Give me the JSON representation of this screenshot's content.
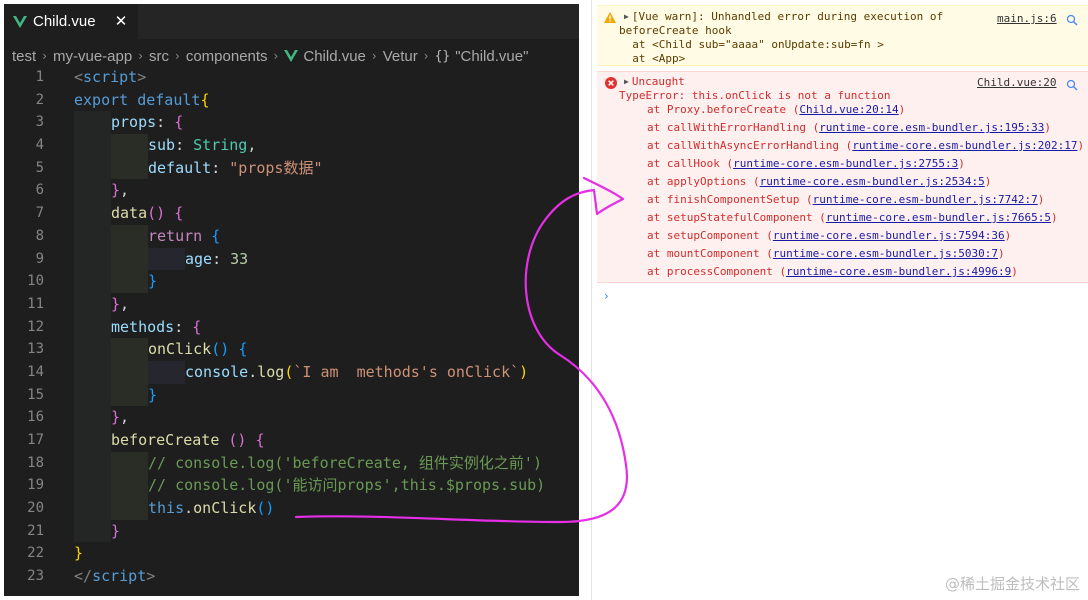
{
  "editor": {
    "tab": {
      "label": "Child.vue",
      "close_glyph": "✕"
    },
    "breadcrumb": [
      "test",
      "my-vue-app",
      "src",
      "components",
      "Child.vue",
      "Vetur",
      "\"Child.vue\""
    ],
    "braces_glyph": "{}",
    "lines": [
      {
        "n": "1",
        "indent": 0,
        "tokens": [
          [
            "t-punct-tag",
            "<"
          ],
          [
            "t-tag",
            "script"
          ],
          [
            "t-punct-tag",
            ">"
          ]
        ]
      },
      {
        "n": "2",
        "indent": 0,
        "tokens": [
          [
            "t-kw",
            "export"
          ],
          [
            "t-plain",
            " "
          ],
          [
            "t-kw",
            "default"
          ],
          [
            "t-brace1",
            "{"
          ]
        ]
      },
      {
        "n": "3",
        "indent": 1,
        "tokens": [
          [
            "t-prop",
            "props"
          ],
          [
            "t-plain",
            ": "
          ],
          [
            "t-brace2",
            "{"
          ]
        ]
      },
      {
        "n": "4",
        "indent": 2,
        "tokens": [
          [
            "t-prop",
            "sub"
          ],
          [
            "t-plain",
            ": "
          ],
          [
            "t-type",
            "String"
          ],
          [
            "t-plain",
            ","
          ]
        ]
      },
      {
        "n": "5",
        "indent": 2,
        "tokens": [
          [
            "t-prop",
            "default"
          ],
          [
            "t-plain",
            ": "
          ],
          [
            "t-str",
            "\"props数据\""
          ]
        ]
      },
      {
        "n": "6",
        "indent": 1,
        "tokens": [
          [
            "t-brace2",
            "}"
          ],
          [
            "t-plain",
            ","
          ]
        ]
      },
      {
        "n": "7",
        "indent": 1,
        "tokens": [
          [
            "t-fn",
            "data"
          ],
          [
            "t-brace2",
            "()"
          ],
          [
            "t-plain",
            " "
          ],
          [
            "t-brace2",
            "{"
          ]
        ]
      },
      {
        "n": "8",
        "indent": 2,
        "tokens": [
          [
            "t-ctrl",
            "return"
          ],
          [
            "t-plain",
            " "
          ],
          [
            "t-brace3",
            "{"
          ]
        ]
      },
      {
        "n": "9",
        "indent": 3,
        "tokens": [
          [
            "t-prop",
            "age"
          ],
          [
            "t-plain",
            ": "
          ],
          [
            "t-num",
            "33"
          ]
        ]
      },
      {
        "n": "10",
        "indent": 2,
        "tokens": [
          [
            "t-brace3",
            "}"
          ]
        ]
      },
      {
        "n": "11",
        "indent": 1,
        "tokens": [
          [
            "t-brace2",
            "}"
          ],
          [
            "t-plain",
            ","
          ]
        ]
      },
      {
        "n": "12",
        "indent": 1,
        "tokens": [
          [
            "t-prop",
            "methods"
          ],
          [
            "t-plain",
            ": "
          ],
          [
            "t-brace2",
            "{"
          ]
        ]
      },
      {
        "n": "13",
        "indent": 2,
        "tokens": [
          [
            "t-fn",
            "onClick"
          ],
          [
            "t-brace3",
            "()"
          ],
          [
            "t-plain",
            " "
          ],
          [
            "t-brace3",
            "{"
          ]
        ]
      },
      {
        "n": "14",
        "indent": 3,
        "tokens": [
          [
            "t-prop",
            "console"
          ],
          [
            "t-plain",
            "."
          ],
          [
            "t-fn",
            "log"
          ],
          [
            "t-brace1",
            "("
          ],
          [
            "t-str",
            "`I am  methods's onClick`"
          ],
          [
            "t-brace1",
            ")"
          ]
        ]
      },
      {
        "n": "15",
        "indent": 2,
        "tokens": [
          [
            "t-brace3",
            "}"
          ]
        ]
      },
      {
        "n": "16",
        "indent": 1,
        "tokens": [
          [
            "t-brace2",
            "}"
          ],
          [
            "t-plain",
            ","
          ]
        ]
      },
      {
        "n": "17",
        "indent": 1,
        "tokens": [
          [
            "t-fn",
            "beforeCreate"
          ],
          [
            "t-plain",
            " "
          ],
          [
            "t-brace2",
            "()"
          ],
          [
            "t-plain",
            " "
          ],
          [
            "t-brace2",
            "{"
          ]
        ]
      },
      {
        "n": "18",
        "indent": 2,
        "tokens": [
          [
            "t-cmt",
            "// console.log('beforeCreate, 组件实例化之前')"
          ]
        ]
      },
      {
        "n": "19",
        "indent": 2,
        "tokens": [
          [
            "t-cmt",
            "// console.log('能访问props',this.$props.sub)"
          ]
        ]
      },
      {
        "n": "20",
        "indent": 2,
        "tokens": [
          [
            "t-kw",
            "this"
          ],
          [
            "t-plain",
            "."
          ],
          [
            "t-fn",
            "onClick"
          ],
          [
            "t-brace3",
            "()"
          ]
        ]
      },
      {
        "n": "21",
        "indent": 1,
        "tokens": [
          [
            "t-brace2",
            "}"
          ]
        ]
      },
      {
        "n": "22",
        "indent": 0,
        "tokens": [
          [
            "t-brace1",
            "}"
          ]
        ]
      },
      {
        "n": "23",
        "indent": 0,
        "tokens": [
          [
            "t-punct-tag",
            "</"
          ],
          [
            "t-tag",
            "script"
          ],
          [
            "t-punct-tag",
            ">"
          ]
        ]
      }
    ]
  },
  "console": {
    "warning": {
      "lines": [
        "[Vue warn]: Unhandled error during execution of",
        "beforeCreate hook",
        "  at <Child sub=\"aaaa\" onUpdate:sub=fn >",
        "  at <App>"
      ],
      "source": "main.js:6"
    },
    "error": {
      "title": "Uncaught",
      "message": "TypeError: this.onClick is not a function",
      "source": "Child.vue:20",
      "stack": [
        {
          "fn": "at Proxy.beforeCreate (",
          "loc": "Child.vue:20:14",
          "end": ")"
        },
        {
          "fn": "at callWithErrorHandling (",
          "loc": "runtime-core.esm-bundler.js:195:33",
          "end": ")"
        },
        {
          "fn": "at callWithAsyncErrorHandling (",
          "loc": "runtime-core.esm-bundler.js:202:17",
          "end": ")"
        },
        {
          "fn": "at callHook (",
          "loc": "runtime-core.esm-bundler.js:2755:3",
          "end": ")"
        },
        {
          "fn": "at applyOptions (",
          "loc": "runtime-core.esm-bundler.js:2534:5",
          "end": ")"
        },
        {
          "fn": "at finishComponentSetup (",
          "loc": "runtime-core.esm-bundler.js:7742:7",
          "end": ")"
        },
        {
          "fn": "at setupStatefulComponent (",
          "loc": "runtime-core.esm-bundler.js:7665:5",
          "end": ")"
        },
        {
          "fn": "at setupComponent (",
          "loc": "runtime-core.esm-bundler.js:7594:36",
          "end": ")"
        },
        {
          "fn": "at mountComponent (",
          "loc": "runtime-core.esm-bundler.js:5030:7",
          "end": ")"
        },
        {
          "fn": "at processComponent (",
          "loc": "runtime-core.esm-bundler.js:4996:9",
          "end": ")"
        }
      ]
    },
    "prompt_glyph": "›"
  },
  "watermark": "@稀土掘金技术社区",
  "colors": {
    "editor_bg": "#1e1e1e",
    "annotation": "#e62ee6",
    "vue_green": "#41b883"
  }
}
